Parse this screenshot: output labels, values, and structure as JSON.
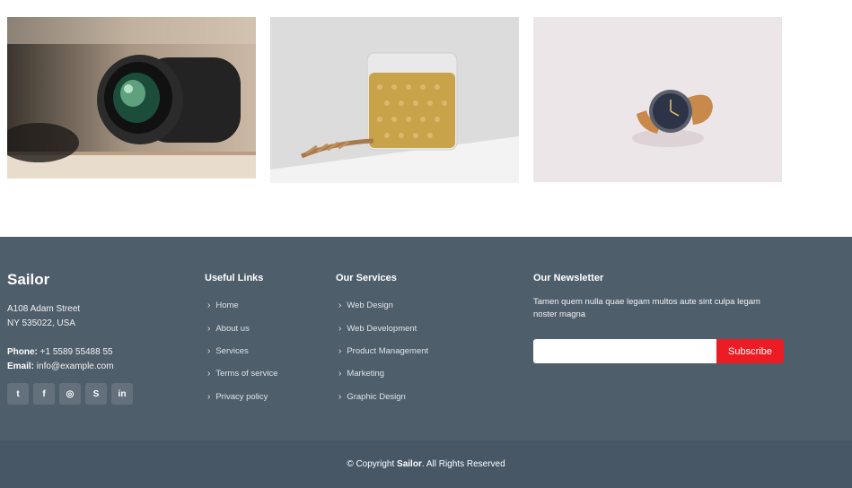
{
  "footer": {
    "brand": "Sailor",
    "address_line1": "A108 Adam Street",
    "address_line2": "NY 535022, USA",
    "phone_label": "Phone:",
    "phone": "+1 5589 55488 55",
    "email_label": "Email:",
    "email": "info@example.com",
    "social": [
      {
        "icon": "twitter-icon",
        "glyph": "t"
      },
      {
        "icon": "facebook-icon",
        "glyph": "f"
      },
      {
        "icon": "instagram-icon",
        "glyph": "◎"
      },
      {
        "icon": "skype-icon",
        "glyph": "S"
      },
      {
        "icon": "linkedin-icon",
        "glyph": "in"
      }
    ],
    "useful_links": {
      "title": "Useful Links",
      "items": [
        "Home",
        "About us",
        "Services",
        "Terms of service",
        "Privacy policy"
      ]
    },
    "services": {
      "title": "Our Services",
      "items": [
        "Web Design",
        "Web Development",
        "Product Management",
        "Marketing",
        "Graphic Design"
      ]
    },
    "newsletter": {
      "title": "Our Newsletter",
      "text": "Tamen quem nulla quae legam multos aute sint culpa legam noster magna",
      "input_value": "",
      "button": "Subscribe"
    }
  },
  "copyright": {
    "prefix": "© Copyright",
    "brand": "Sailor",
    "suffix": ". All Rights Reserved"
  },
  "colors": {
    "footer_bg": "#4f5e6b",
    "bottom_bg": "#485766",
    "accent": "#ed1c24"
  }
}
